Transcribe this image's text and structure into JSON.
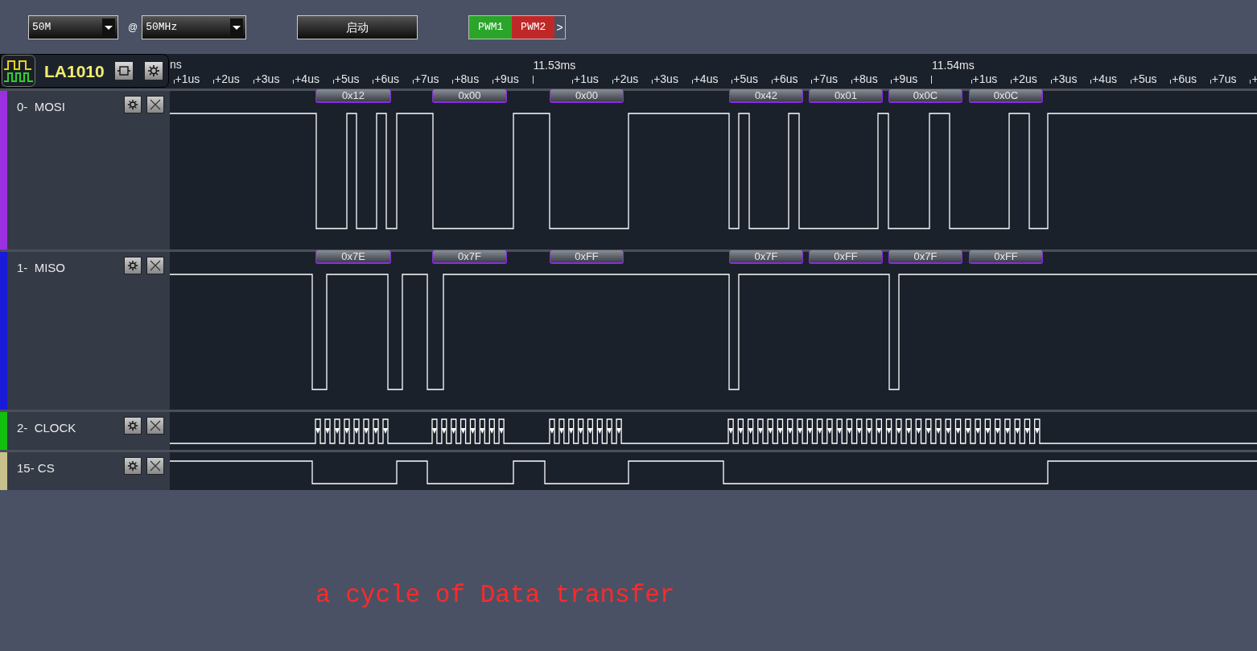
{
  "toolbar": {
    "sample_depth": {
      "value": "50M"
    },
    "at_sign": "@",
    "sample_rate": {
      "value": "50MHz"
    },
    "start_button": "启动",
    "pwm_tabs": [
      {
        "label": "PWM1",
        "color": "#2aa52a"
      },
      {
        "label": "PWM2",
        "color": "#c02828"
      }
    ],
    "more_button": ">"
  },
  "device": {
    "name": "LA1010"
  },
  "ruler": {
    "edge_label": "ns",
    "ticks": [
      {
        "label": "+1us",
        "kind": "minor"
      },
      {
        "label": "+2us",
        "kind": "minor"
      },
      {
        "label": "+3us",
        "kind": "minor"
      },
      {
        "label": "+4us",
        "kind": "minor"
      },
      {
        "label": "+5us",
        "kind": "minor"
      },
      {
        "label": "+6us",
        "kind": "minor"
      },
      {
        "label": "+7us",
        "kind": "minor"
      },
      {
        "label": "+8us",
        "kind": "minor"
      },
      {
        "label": "+9us",
        "kind": "minor"
      },
      {
        "label": "11.53ms",
        "kind": "major"
      },
      {
        "label": "+1us",
        "kind": "minor"
      },
      {
        "label": "+2us",
        "kind": "minor"
      },
      {
        "label": "+3us",
        "kind": "minor"
      },
      {
        "label": "+4us",
        "kind": "minor"
      },
      {
        "label": "+5us",
        "kind": "minor"
      },
      {
        "label": "+6us",
        "kind": "minor"
      },
      {
        "label": "+7us",
        "kind": "minor"
      },
      {
        "label": "+8us",
        "kind": "minor"
      },
      {
        "label": "+9us",
        "kind": "minor"
      },
      {
        "label": "11.54ms",
        "kind": "major"
      },
      {
        "label": "+1us",
        "kind": "minor"
      },
      {
        "label": "+2us",
        "kind": "minor"
      },
      {
        "label": "+3us",
        "kind": "minor"
      },
      {
        "label": "+4us",
        "kind": "minor"
      },
      {
        "label": "+5us",
        "kind": "minor"
      },
      {
        "label": "+6us",
        "kind": "minor"
      },
      {
        "label": "+7us",
        "kind": "minor"
      },
      {
        "label": "+",
        "kind": "minor"
      }
    ]
  },
  "channels": [
    {
      "label": "0-  MOSI",
      "color": "#9b30e0",
      "kind": "tall",
      "decoded": [
        "0x12",
        "0x00",
        "0x00",
        "0x42",
        "0x01",
        "0x0C",
        "0x0C"
      ]
    },
    {
      "label": "1-  MISO",
      "color": "#1a1ad8",
      "kind": "tall",
      "decoded": [
        "0x7E",
        "0x7F",
        "0xFF",
        "0x7F",
        "0xFF",
        "0x7F",
        "0xFF"
      ]
    },
    {
      "label": "2-  CLOCK",
      "color": "#12c012",
      "kind": "short"
    },
    {
      "label": "15- CS",
      "color": "#c8c08c",
      "kind": "short"
    }
  ],
  "caption": "a cycle of Data transfer"
}
